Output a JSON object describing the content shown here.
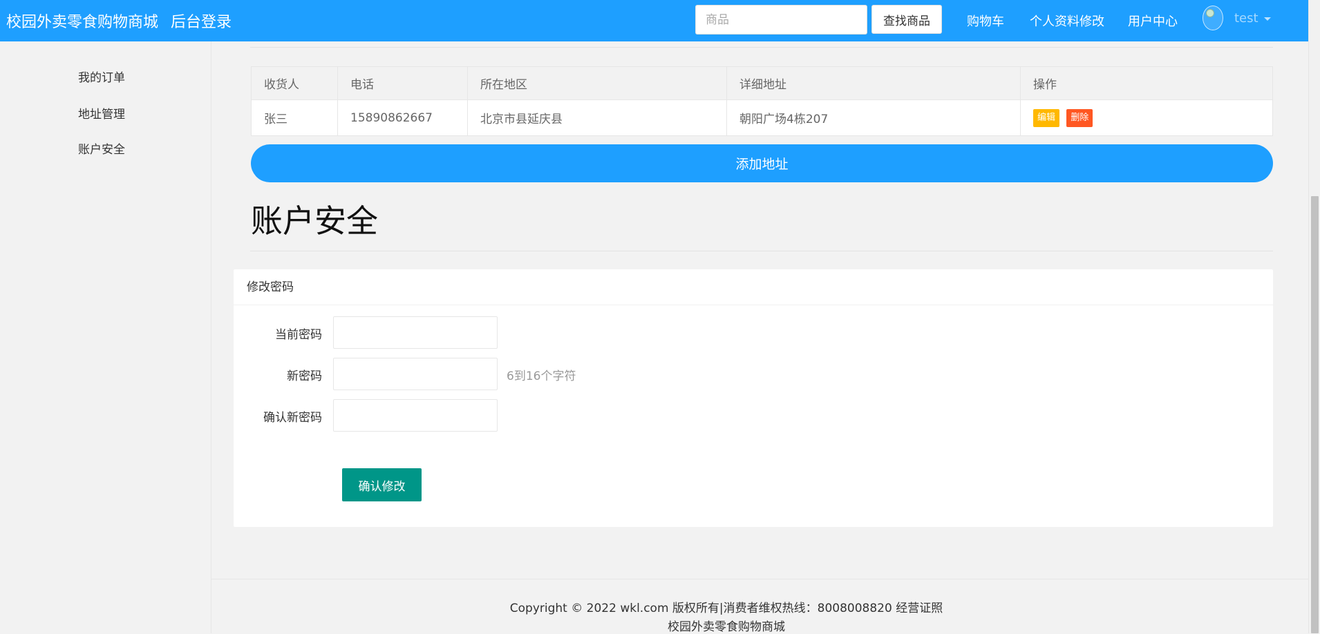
{
  "header": {
    "brand": "校园外卖零食购物商城",
    "admin_login": "后台登录",
    "search_placeholder": "商品",
    "search_button": "查找商品",
    "nav": {
      "cart": "购物车",
      "profile_edit": "个人资料修改",
      "user_center": "用户中心"
    },
    "username": "test"
  },
  "sidebar": {
    "items": [
      {
        "label": "我的订单"
      },
      {
        "label": "地址管理"
      },
      {
        "label": "账户安全"
      }
    ]
  },
  "address_table": {
    "columns": [
      "收货人",
      "电话",
      "所在地区",
      "详细地址",
      "操作"
    ],
    "rows": [
      {
        "name": "张三",
        "phone": "15890862667",
        "region": "北京市县延庆县",
        "detail": "朝阳广场4栋207",
        "edit": "编辑",
        "delete": "删除"
      }
    ]
  },
  "add_address_button": "添加地址",
  "security": {
    "title": "账户安全",
    "card_title": "修改密码",
    "fields": {
      "current": {
        "label": "当前密码"
      },
      "new": {
        "label": "新密码",
        "hint": "6到16个字符"
      },
      "confirm": {
        "label": "确认新密码"
      }
    },
    "submit": "确认修改"
  },
  "footer": {
    "copyright": "Copyright © 2022 wkl.com 版权所有|消费者维权热线：8008008820 经营证照",
    "brand": "校园外卖零食购物商城"
  },
  "colors": {
    "primary": "#1e9fff",
    "warm": "#ffb800",
    "danger": "#ff5722",
    "teal": "#009688"
  }
}
